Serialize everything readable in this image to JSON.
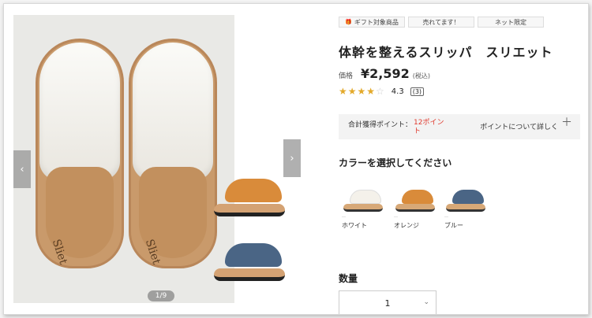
{
  "gallery": {
    "pager": "1/9",
    "prev_arrow": "‹",
    "next_arrow": "›",
    "brand_mark": "Sliet"
  },
  "badges": [
    {
      "icon": "gift-icon",
      "label": "ギフト対象商品"
    },
    {
      "label": "売れてます！"
    },
    {
      "label": "ネット限定"
    }
  ],
  "product": {
    "title": "体幹を整えるスリッパ　スリエット",
    "price_label": "価格",
    "price": "¥2,592",
    "tax_note": "(税込)"
  },
  "rating": {
    "stars": 4.5,
    "value": "4.3",
    "reviews": "(3)",
    "star_full": "★★★★",
    "star_half": "☆"
  },
  "points": {
    "label": "合計獲得ポイント：",
    "value": "12ポイント",
    "more_link": "ポイントについて詳しく",
    "plus": "＋"
  },
  "colors": {
    "heading": "カラーを選択してください",
    "dash": "―",
    "options": [
      {
        "name": "ホワイト",
        "color": "#f4f1ea"
      },
      {
        "name": "オレンジ",
        "color": "#d98b3a"
      },
      {
        "name": "ブルー",
        "color": "#4a6585"
      }
    ]
  },
  "quantity": {
    "heading": "数量",
    "value": "1",
    "chevron": "⌄"
  }
}
